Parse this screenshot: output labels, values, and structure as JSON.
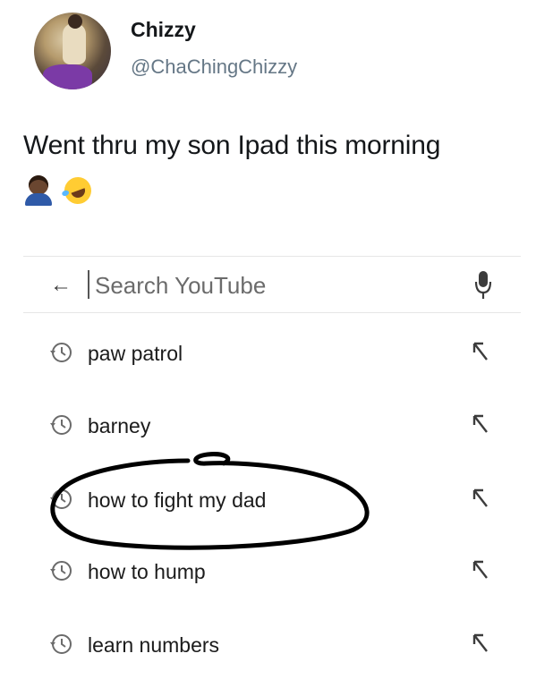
{
  "tweet": {
    "display_name": "Chizzy",
    "handle": "@ChaChingChizzy",
    "text": "Went thru my son Ipad this morning",
    "emojis": [
      "man-emoji-medium-dark-skin",
      "rolling-on-floor-laughing-emoji"
    ]
  },
  "youtube_search": {
    "back_icon": "arrow-left-icon",
    "placeholder": "Search YouTube",
    "mic_icon": "microphone-icon",
    "suggestions": [
      {
        "label": "paw patrol",
        "icon": "history-icon",
        "action_icon": "arrow-up-left-icon"
      },
      {
        "label": "barney",
        "icon": "history-icon",
        "action_icon": "arrow-up-left-icon"
      },
      {
        "label": "how to fight my dad",
        "icon": "history-icon",
        "action_icon": "arrow-up-left-icon",
        "circled": true
      },
      {
        "label": "how to hump",
        "icon": "history-icon",
        "action_icon": "arrow-up-left-icon"
      },
      {
        "label": "learn numbers",
        "icon": "history-icon",
        "action_icon": "arrow-up-left-icon"
      }
    ]
  },
  "colors": {
    "name": "#14171a",
    "handle": "#657786",
    "scribble": "#000000"
  }
}
